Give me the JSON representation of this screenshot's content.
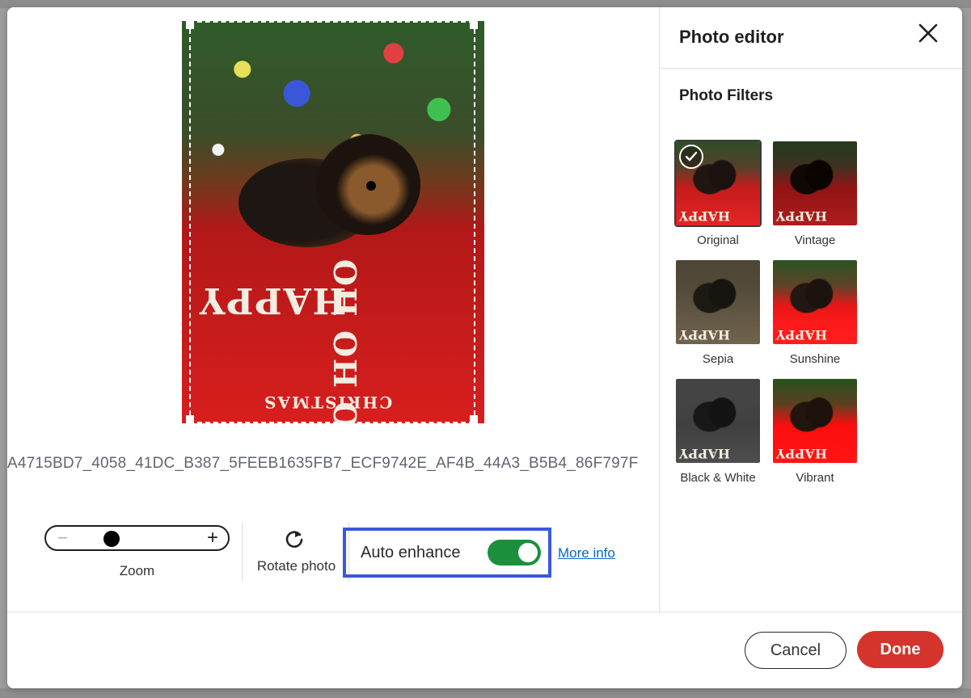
{
  "photo": {
    "filename": "A4715BD7_4058_41DC_B387_5FEEB1635FB7_ECF9742E_AF4B_44A3_B5B4_86F797F",
    "wrap_text_happy": "HAPPY",
    "wrap_text_hoho": "HO HO HO",
    "wrap_text_christmas": "CHRISTMAS"
  },
  "controls": {
    "zoom_label": "Zoom",
    "zoom_minus": "−",
    "zoom_plus": "+",
    "zoom_level": 0.22,
    "rotate_label": "Rotate photo",
    "auto_enhance_label": "Auto enhance",
    "auto_enhance_on": true,
    "more_info_label": "More info"
  },
  "sidebar": {
    "title": "Photo editor",
    "filters_title": "Photo Filters",
    "filters": [
      {
        "label": "Original",
        "selected": true
      },
      {
        "label": "Vintage",
        "selected": false
      },
      {
        "label": "Sepia",
        "selected": false
      },
      {
        "label": "Sunshine",
        "selected": false
      },
      {
        "label": "Black & White",
        "selected": false
      },
      {
        "label": "Vibrant",
        "selected": false
      }
    ]
  },
  "footer": {
    "cancel_label": "Cancel",
    "done_label": "Done"
  },
  "colors": {
    "accent_blue": "#3a57e0",
    "toggle_green": "#1c8f3c",
    "done_red": "#d4342b",
    "link_blue": "#0a66c2"
  },
  "icons": {
    "close": "close-icon",
    "rotate": "rotate-icon",
    "check": "check-icon"
  }
}
